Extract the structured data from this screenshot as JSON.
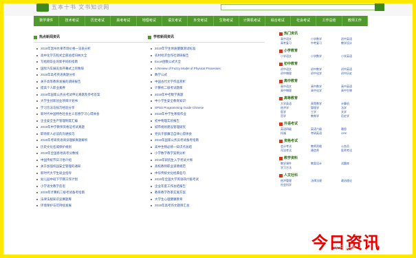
{
  "header": {
    "logo_text": "五本十书 文书知识网",
    "search_placeholder": ""
  },
  "nav": [
    "数学课件",
    "技术考试",
    "历史考试",
    "高考考试",
    "地理考试",
    "语文考试",
    "外交考试",
    "生物考试",
    "计算机考试",
    "综合考试",
    "社会考试",
    "工作总结",
    "教师工作"
  ],
  "left": {
    "title": "热点新闻资讯",
    "items": [
      "2019年温州水果市场价格一览表分析",
      "高中化学方程式全部总结归纳大全",
      "写给刚毕业的新手妈妈指南",
      "国际汽车展览会开幕式上的致辞",
      "2019年高考英语真题分析",
      "关于高等教育发展的调研报告",
      "提高个人职业素养",
      "2019年国家公务员考试申论真题及参考答案",
      "大学生创新创业项目计划书",
      "学习方法与技巧经验分享",
      "新时代中国特色社会主义思想学习心得体会",
      "企业安全生产管理制度汇编",
      "2019年中学教师资格证考试真题",
      "职场新人必读的沟通技巧",
      "2019年考研英语阅读理解真题解析",
      "历史文化名城保护规划",
      "2019年全国各地高考分数线",
      "中国传统节日习俗介绍",
      "关于加强校园安全管理的通知",
      "新时代大学生就业指导",
      "幼儿园中班下学期工作计划",
      "小学语文教学反思",
      "2019年计算机二级考试备考指南",
      "法律法规知识竞赛题库",
      "环境保护与可持续发展"
    ]
  },
  "mid": {
    "title": "学校新闻资讯",
    "items": [
      "2019年学生体质健康测试标准",
      "农村经济合作社调研报告",
      "Excel函数公式大全",
      "A Review of Fuzzy Model of Physical Processes",
      "数学公式",
      "中国古代文学作品赏析",
      "计算机二级考试题库",
      "2019年中考数学真题",
      "中小学生安全教育知识",
      "SPSS Programming Guide Chinese",
      "2019年中学生寒假作业",
      "初中物理实验报告",
      "城市规划建设管理研究",
      "党员干部廉洁自律心得体会",
      "2019年国家公务员考试备考指南",
      "高中生物必修一知识点总结",
      "小学数学教学案例分析",
      "2019年研究生入学考试大纲",
      "高校教师职业道德规范",
      "中华传统文化经典名句",
      "2019年全国大学英语四六级考试",
      "企业年度工作总结报告",
      "教育教学改革实施方案",
      "大学生心理健康教育",
      "2019年高考作文题目汇总"
    ]
  },
  "side": [
    {
      "title": "热门资讯",
      "items": [
        "高中语文",
        "小学数学",
        "初中英语",
        "高考复习",
        "中考复习",
        "教学设计"
      ]
    },
    {
      "title": "小学教育",
      "items": [
        "小学语文",
        "小学数学",
        "小学英语"
      ]
    },
    {
      "title": "初中教育",
      "items": [
        "初中语文",
        "初中数学",
        "初中英语",
        "初中物理",
        "初中化学",
        "初中历史"
      ]
    },
    {
      "title": "高中教育",
      "items": [
        "高中语文",
        "高中数学",
        "高中英语",
        "高中物理",
        "高中化学",
        "高中生物"
      ]
    },
    {
      "title": "高等教育",
      "items": [
        "大学英语",
        "高等数学",
        "计算机",
        "经济学",
        "管理学",
        "法学",
        "医学",
        "工学",
        "文学",
        "哲学",
        "教育学",
        "历史学"
      ]
    },
    {
      "title": "外语考试",
      "items": [
        "英语四级",
        "英语六级",
        "雅思",
        "托福",
        "考研英语",
        "GRE"
      ]
    },
    {
      "title": "资格考试",
      "items": [
        "会计考试",
        "教师资格",
        "公务员",
        "司法考试",
        "建造师",
        "医师考试"
      ]
    },
    {
      "title": "教学资料",
      "items": [
        "教学课件",
        "教案设计",
        "试题库",
        "学习方法"
      ]
    },
    {
      "title": "人文社科",
      "items": [
        "经济管理",
        "法律法规",
        "政治理论",
        "社会科学"
      ]
    }
  ],
  "watermark": {
    "text": "今日资讯",
    "faint": "今日头条"
  }
}
